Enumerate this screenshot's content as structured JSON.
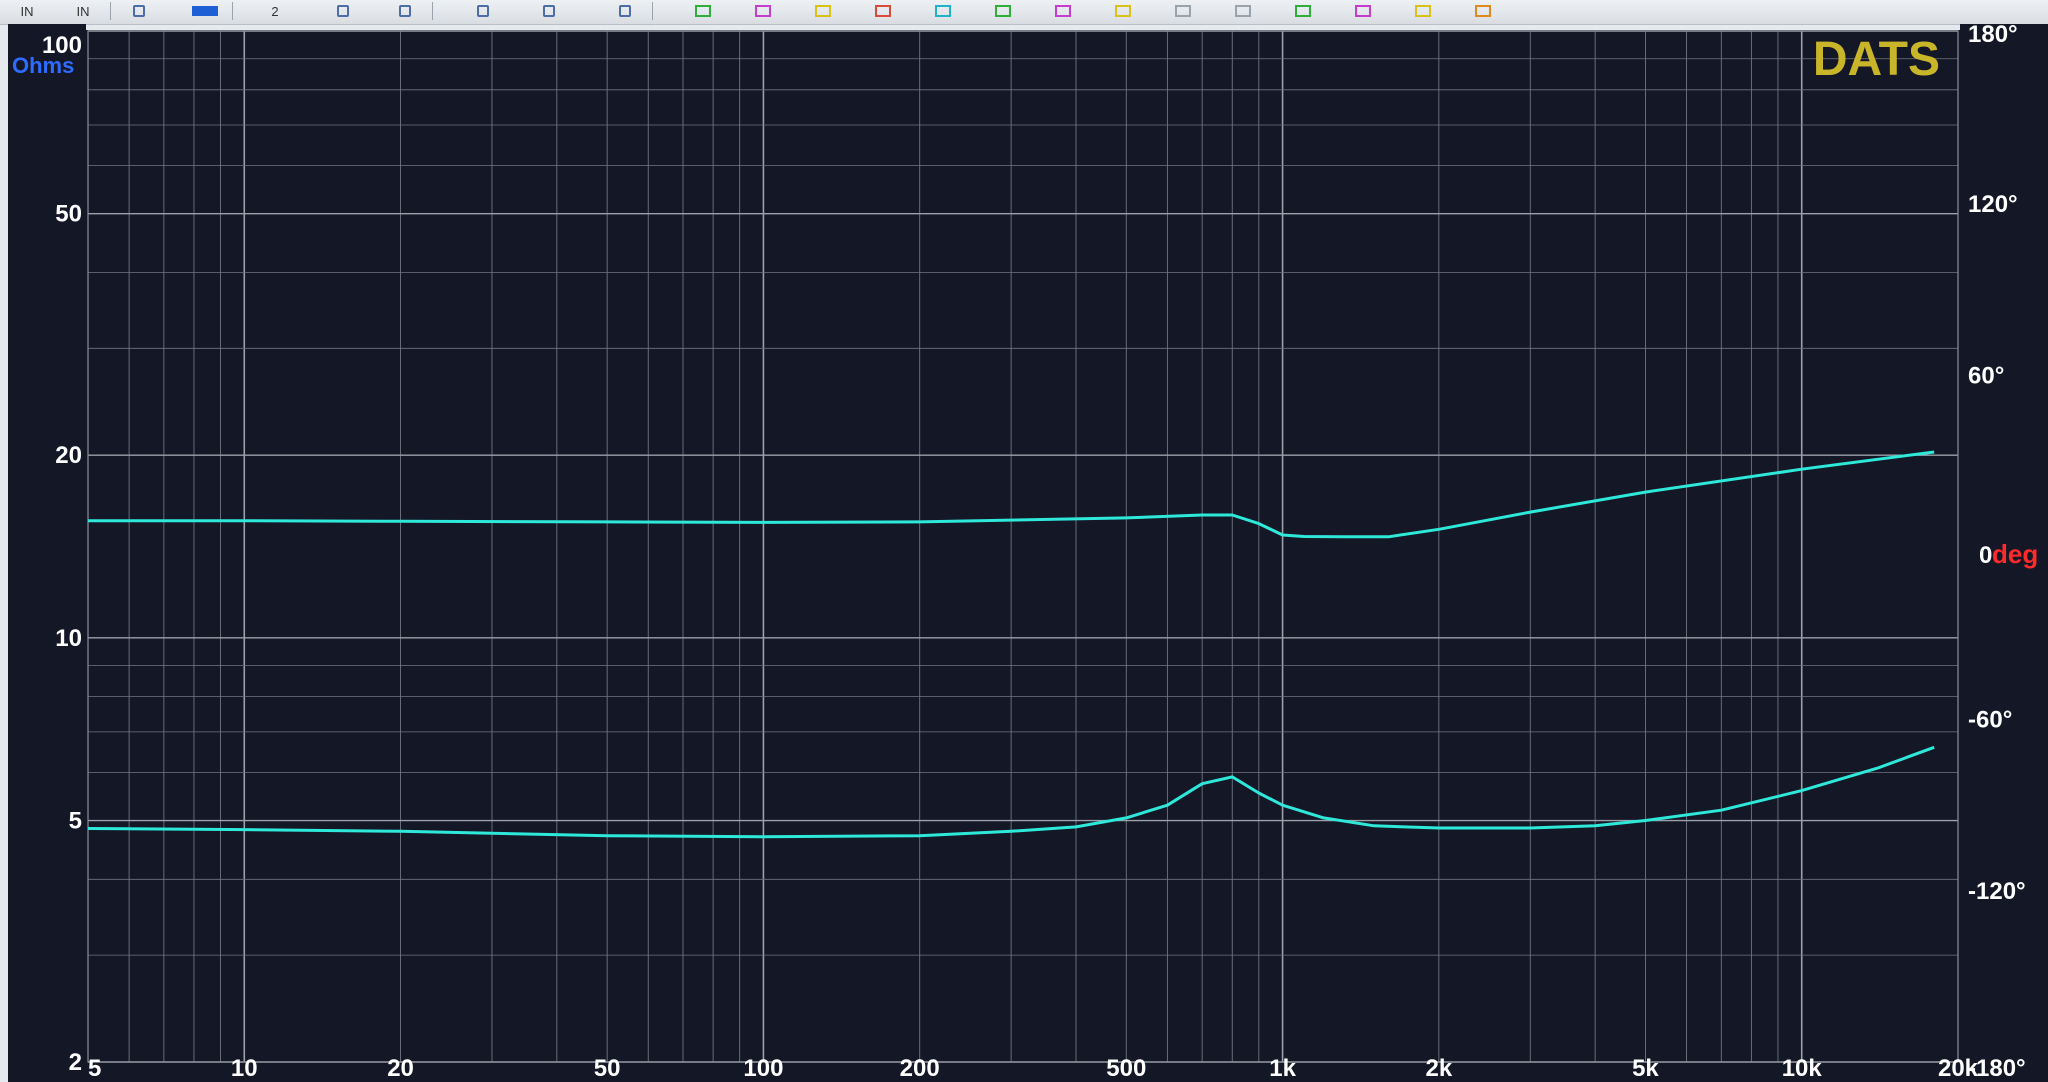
{
  "toolbar": {
    "buttons": [
      {
        "name": "in-button-1",
        "label": "IN",
        "kind": "text"
      },
      {
        "name": "in-button-2",
        "label": "IN",
        "kind": "text"
      },
      {
        "name": "grid-icon",
        "label": "",
        "kind": "icon"
      },
      {
        "name": "color-swatch-icon",
        "label": "",
        "kind": "swatch",
        "color": "#1f5fd6"
      },
      {
        "name": "tool-button-2",
        "label": "2",
        "kind": "text"
      },
      {
        "name": "rotate-icon",
        "label": "",
        "kind": "icon"
      },
      {
        "name": "cursor-icon",
        "label": "",
        "kind": "icon"
      },
      {
        "name": "diamond-icon",
        "label": "",
        "kind": "icon"
      },
      {
        "name": "scale-icon",
        "label": "",
        "kind": "icon"
      },
      {
        "name": "star-icon",
        "label": "",
        "kind": "icon"
      },
      {
        "name": "trace-icon-green-1",
        "label": "",
        "kind": "trace",
        "color": "#2fae3a"
      },
      {
        "name": "trace-icon-magenta-1",
        "label": "",
        "kind": "trace",
        "color": "#c53ccf"
      },
      {
        "name": "trace-icon-yellow-1",
        "label": "",
        "kind": "trace",
        "color": "#d8c21a"
      },
      {
        "name": "trace-icon-red",
        "label": "",
        "kind": "trace",
        "color": "#d94a3a"
      },
      {
        "name": "trace-icon-cyan",
        "label": "",
        "kind": "trace",
        "color": "#1fb3c9"
      },
      {
        "name": "trace-icon-green-2",
        "label": "",
        "kind": "trace",
        "color": "#2fae3a"
      },
      {
        "name": "trace-icon-magenta-2",
        "label": "",
        "kind": "trace",
        "color": "#c53ccf"
      },
      {
        "name": "trace-icon-yellow-2",
        "label": "",
        "kind": "trace",
        "color": "#d8c21a"
      },
      {
        "name": "trace-icon-gray-1",
        "label": "",
        "kind": "trace",
        "color": "#9aa2ab"
      },
      {
        "name": "trace-icon-gray-2",
        "label": "",
        "kind": "trace",
        "color": "#9aa2ab"
      },
      {
        "name": "trace-icon-green-3",
        "label": "",
        "kind": "trace",
        "color": "#2fae3a"
      },
      {
        "name": "trace-icon-magenta-3",
        "label": "",
        "kind": "trace",
        "color": "#c53ccf"
      },
      {
        "name": "trace-icon-yellow-3",
        "label": "",
        "kind": "trace",
        "color": "#d8c21a"
      },
      {
        "name": "trace-icon-orange",
        "label": "",
        "kind": "trace",
        "color": "#e08a1e"
      }
    ]
  },
  "chart_data": {
    "type": "line",
    "title": "DATS",
    "xscale": "log",
    "yscale": "log",
    "xlim": [
      5,
      20000
    ],
    "ylim": [
      2,
      100
    ],
    "y2lim": [
      -180,
      180
    ],
    "x_ticks": [
      "5",
      "10",
      "20",
      "50",
      "100",
      "200",
      "500",
      "1k",
      "2k",
      "5k",
      "10k",
      "20k"
    ],
    "x_tick_values": [
      5,
      10,
      20,
      50,
      100,
      200,
      500,
      1000,
      2000,
      5000,
      10000,
      20000
    ],
    "y_ticks": [
      "100",
      "50",
      "20",
      "10",
      "5",
      "2"
    ],
    "y_tick_values": [
      100,
      50,
      20,
      10,
      5,
      2
    ],
    "y_unit_label": "Ohms",
    "y2_ticks": [
      "180°",
      "120°",
      "60°",
      "0",
      "-60°",
      "-120°",
      "-180°"
    ],
    "y2_tick_values": [
      180,
      120,
      60,
      0,
      -60,
      -120,
      -180
    ],
    "y2_unit_label": "deg",
    "legend": "none",
    "grid": true,
    "colors": {
      "background": "#141726",
      "grid": "#6f7680",
      "grid_major": "#9aa1aa",
      "trace": "#2ee8da",
      "title": "#c9b52a",
      "ohms_label": "#2e6bff",
      "deg_label": "#ff2a2a",
      "tick_text": "#ffffff"
    },
    "series": [
      {
        "axis": "y2",
        "x": [
          5,
          10,
          20,
          50,
          100,
          200,
          500,
          700,
          800,
          900,
          1000,
          1100,
          1300,
          1600,
          2000,
          3000,
          5000,
          10000,
          18000
        ],
        "values": [
          9,
          9,
          8.8,
          8.6,
          8.4,
          8.6,
          10,
          11,
          11,
          8,
          4,
          3.5,
          3.4,
          3.4,
          6,
          12,
          19,
          27,
          33
        ]
      },
      {
        "axis": "y",
        "x": [
          5,
          10,
          20,
          50,
          100,
          200,
          300,
          400,
          500,
          600,
          700,
          800,
          900,
          1000,
          1200,
          1500,
          2000,
          3000,
          4000,
          5000,
          7000,
          10000,
          14000,
          18000
        ],
        "values": [
          4.85,
          4.83,
          4.8,
          4.72,
          4.7,
          4.72,
          4.8,
          4.88,
          5.05,
          5.3,
          5.75,
          5.9,
          5.55,
          5.3,
          5.05,
          4.9,
          4.86,
          4.86,
          4.9,
          5.0,
          5.2,
          5.6,
          6.1,
          6.6
        ]
      }
    ]
  }
}
